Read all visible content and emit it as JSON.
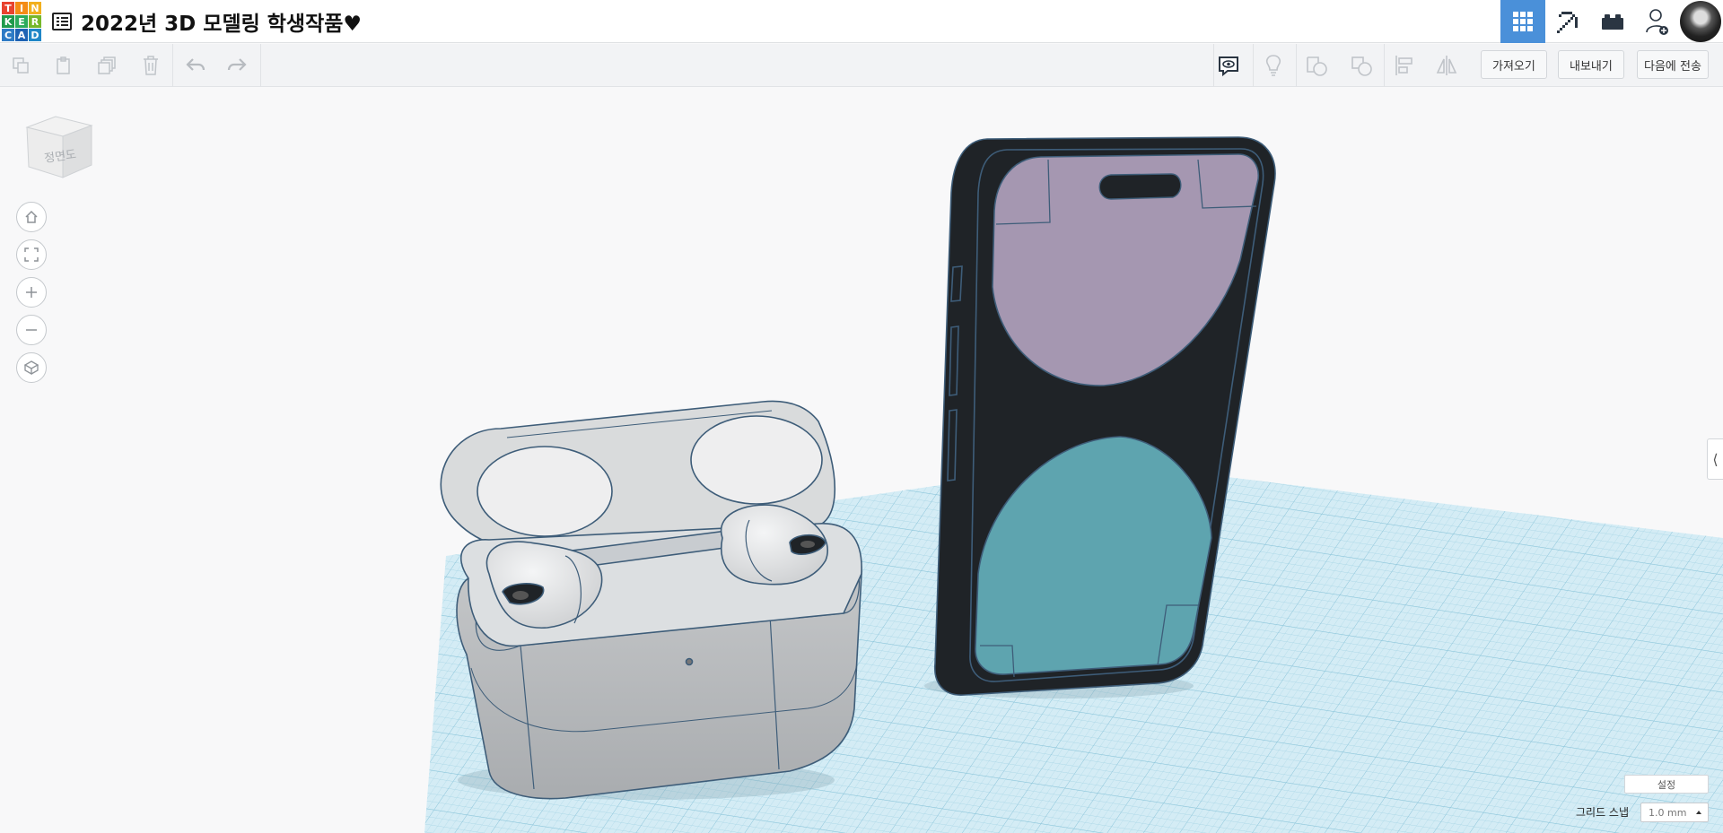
{
  "app": {
    "logo_letters": [
      "T",
      "I",
      "N",
      "K",
      "E",
      "R",
      "C",
      "A",
      "D"
    ],
    "logo_colors": [
      "#e8432f",
      "#f48c16",
      "#f2b01e",
      "#1f9a4c",
      "#2bab5b",
      "#76b72a",
      "#2e7bc5",
      "#1e63b4",
      "#1f86c7"
    ],
    "accent_color": "#4a90d9"
  },
  "header": {
    "title": "2022년 3D 모델링 학생작품♥",
    "menu_icon": "design-list-icon",
    "right_buttons": [
      {
        "name": "3d-design-view-button",
        "icon": "grid-icon",
        "active": true
      },
      {
        "name": "blocks-view-button",
        "icon": "pickaxe-icon",
        "active": false
      },
      {
        "name": "bricks-view-button",
        "icon": "brick-icon",
        "active": false
      },
      {
        "name": "invite-user-button",
        "icon": "add-user-icon",
        "active": false
      }
    ],
    "avatar": "user-avatar"
  },
  "toolbar": {
    "import_label": "가져오기",
    "export_label": "내보내기",
    "send_to_label": "다음에 전송"
  },
  "viewport": {
    "view_cube_label": "정면도",
    "nav_buttons": [
      "home-view-button",
      "fit-view-button",
      "zoom-in-button",
      "zoom-out-button",
      "perspective-button"
    ],
    "colors": {
      "grid_plate": "#cfe9f3",
      "grid_line": "#9fcfe1",
      "phone_body": "#1f2327",
      "phone_screen_top": "#a597b1",
      "phone_screen_bottom": "#5ea4af",
      "case_body": "#b9bcbe",
      "case_lid": "#d9dbdc",
      "edge_line": "#3e5d79"
    }
  },
  "footer": {
    "settings_label": "설정",
    "grid_snap_label": "그리드 스냅",
    "grid_snap_value": "1.0 mm"
  }
}
